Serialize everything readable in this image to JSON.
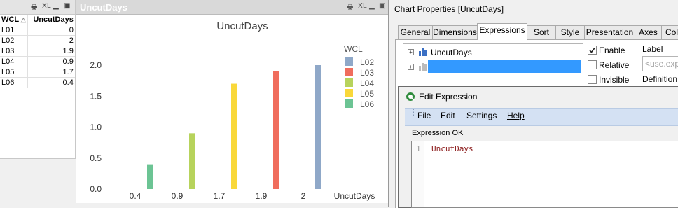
{
  "table_box": {
    "caption_buttons": [
      "🖶",
      "XL",
      "▁",
      "▣"
    ],
    "headers": [
      "WCL",
      "UncutDays"
    ],
    "sort_indicator": "△",
    "rows": [
      {
        "wcl": "L01",
        "value": "0"
      },
      {
        "wcl": "L02",
        "value": "2"
      },
      {
        "wcl": "L03",
        "value": "1.9"
      },
      {
        "wcl": "L04",
        "value": "0.9"
      },
      {
        "wcl": "L05",
        "value": "1.7"
      },
      {
        "wcl": "L06",
        "value": "0.4"
      }
    ]
  },
  "chart_box": {
    "caption": "UncutDays",
    "caption_buttons": [
      "🖶",
      "XL",
      "▁",
      "▣"
    ]
  },
  "chart_data": {
    "type": "bar",
    "title": "UncutDays",
    "xlabel": "UncutDays",
    "ylabel": "",
    "ylim": [
      0,
      2.0
    ],
    "yticks": [
      "0.0",
      "0.5",
      "1.0",
      "1.5",
      "2.0"
    ],
    "categories": [
      "0.4",
      "0.9",
      "1.7",
      "1.9",
      "2"
    ],
    "values": [
      0.4,
      0.9,
      1.7,
      1.9,
      2.0
    ],
    "bar_colors": [
      "#6cc494",
      "#b7d35c",
      "#f9d83a",
      "#f06d5d",
      "#8fa8c8"
    ],
    "legend": {
      "title": "WCL",
      "placement": "top-right",
      "items": [
        {
          "label": "L02",
          "color": "#8fa8c8"
        },
        {
          "label": "L03",
          "color": "#f06d5d"
        },
        {
          "label": "L04",
          "color": "#b7d35c"
        },
        {
          "label": "L05",
          "color": "#f9d83a"
        },
        {
          "label": "L06",
          "color": "#6cc494"
        }
      ]
    },
    "grid": false
  },
  "properties_dialog": {
    "title": "Chart Properties [UncutDays]",
    "tabs": [
      "General",
      "Dimensions",
      "Expressions",
      "Sort",
      "Style",
      "Presentation",
      "Axes",
      "Col"
    ],
    "active_tab": "Expressions",
    "tree_items": [
      "UncutDays",
      ""
    ],
    "checkboxes": [
      {
        "label": "Enable",
        "checked": true
      },
      {
        "label": "Relative",
        "checked": false
      },
      {
        "label": "Invisible",
        "checked": false
      }
    ],
    "label_heading": "Label",
    "label_placeholder": "<use.exp",
    "definition_heading": "Definition"
  },
  "edit_expression": {
    "title": "Edit Expression",
    "menu": [
      "File",
      "Edit",
      "Settings",
      "Help"
    ],
    "status": "Expression OK",
    "line_number": "1",
    "code": "UncutDays"
  }
}
